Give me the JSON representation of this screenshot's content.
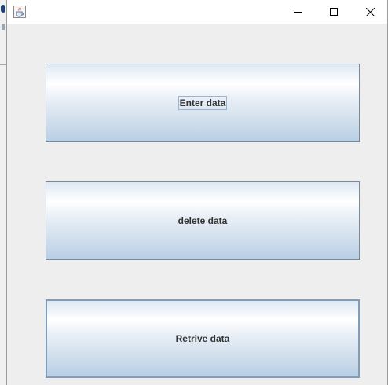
{
  "window": {
    "title": "",
    "controls": {
      "minimize_icon": "minimize-icon",
      "maximize_icon": "maximize-icon",
      "close_icon": "close-icon"
    },
    "app_icon": "java-cup-icon"
  },
  "buttons": [
    {
      "label": "Enter data",
      "focused": true
    },
    {
      "label": "delete data",
      "focused": false
    },
    {
      "label": "Retrive data",
      "focused": false
    }
  ],
  "colors": {
    "content_bg": "#eeeeee",
    "button_border": "#7a8a99",
    "button_gradient_top": "#ffffff",
    "button_gradient_bottom": "#b8cee4",
    "label_text": "#333333"
  }
}
